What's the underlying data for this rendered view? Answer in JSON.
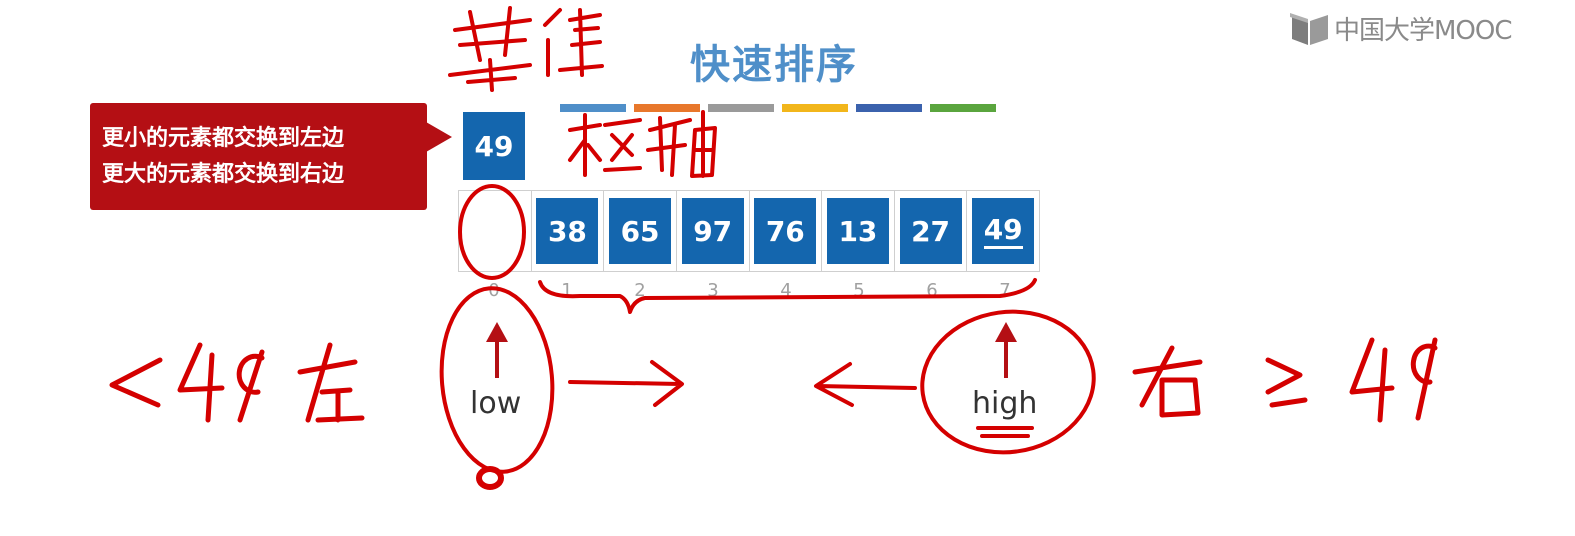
{
  "logo": {
    "text": "中国大学MOOC",
    "icon": "mooc-book-icon"
  },
  "title": "快速排序",
  "color_bars": [
    "#4f8fc9",
    "#e8772b",
    "#9a9a9a",
    "#f2b61b",
    "#3b62ad",
    "#5aa53e"
  ],
  "callout": {
    "line1": "更小的元素都交换到左边",
    "line2": "更大的元素都交换到右边"
  },
  "pivot": {
    "value": "49"
  },
  "array": {
    "cells": [
      {
        "value": ""
      },
      {
        "value": "38"
      },
      {
        "value": "65"
      },
      {
        "value": "97"
      },
      {
        "value": "76"
      },
      {
        "value": "13"
      },
      {
        "value": "27"
      },
      {
        "value": "49"
      }
    ],
    "indices": [
      "0",
      "1",
      "2",
      "3",
      "4",
      "5",
      "6",
      "7"
    ]
  },
  "pointers": {
    "low": "low",
    "high": "high"
  },
  "accent_color": "#b40f14",
  "cell_color": "#1466ae"
}
